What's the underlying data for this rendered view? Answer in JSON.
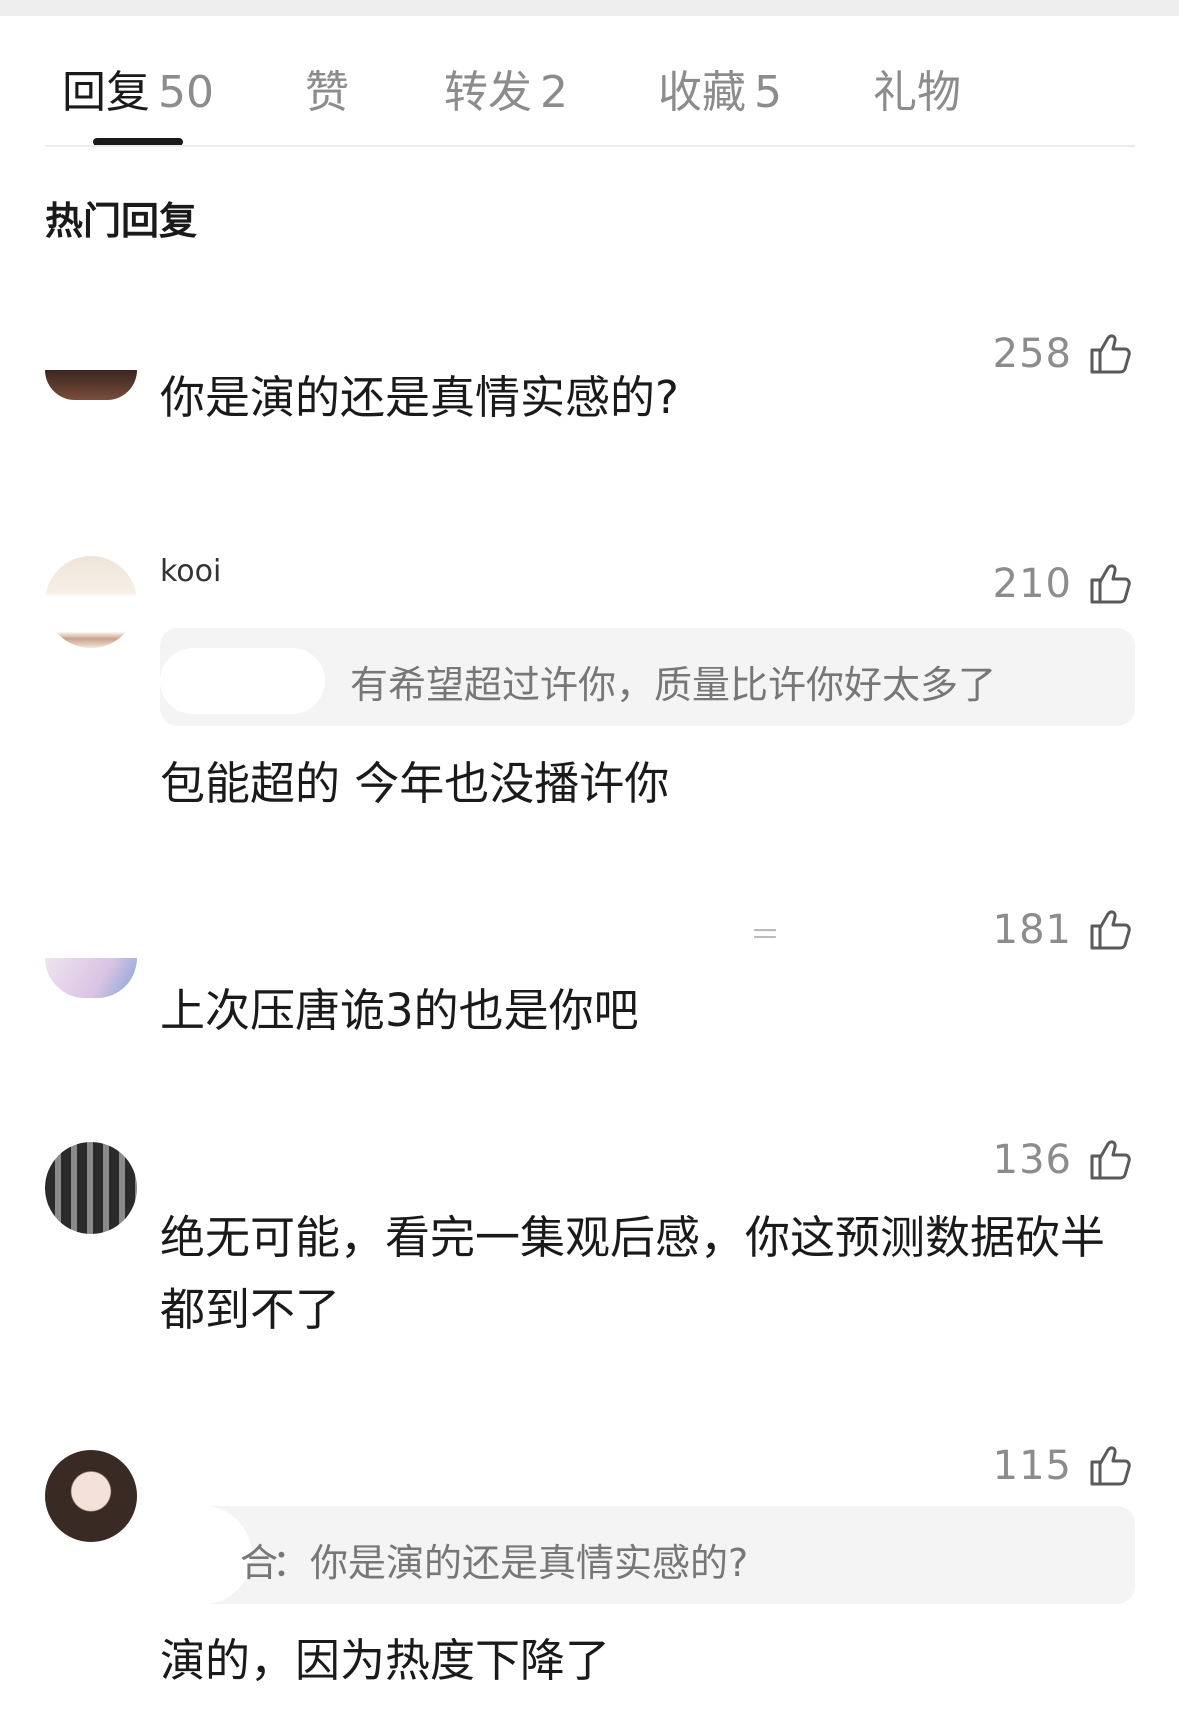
{
  "tabs": [
    {
      "label": "回复",
      "count": "50"
    },
    {
      "label": "赞",
      "count": ""
    },
    {
      "label": "转发",
      "count": "2"
    },
    {
      "label": "收藏",
      "count": "5"
    },
    {
      "label": "礼物",
      "count": ""
    }
  ],
  "section": {
    "title": "热门回复"
  },
  "comments": [
    {
      "likes": "258",
      "text": "你是演的还是真情实感的?",
      "quote": ""
    },
    {
      "likes": "210",
      "text": "包能超的 今年也没播许你",
      "quote": "有希望超过许你，质量比许你好太多了"
    },
    {
      "likes": "181",
      "text": "上次压唐诡3的也是你吧",
      "quote": ""
    },
    {
      "likes": "136",
      "text": "绝无可能，看完一集观后感，你这预测数据砍半都到不了",
      "quote": ""
    },
    {
      "likes": "115",
      "text": "演的，因为热度下降了",
      "quote": "：你是演的还是真情实感的?"
    }
  ],
  "partial_names": {
    "c2": "kooi",
    "c3": "＝",
    "c5_quote_prefix": "合"
  },
  "colors": {
    "text": "#1a1a1a",
    "muted": "#8c8c8c",
    "quote_bg": "#f4f4f5"
  },
  "icons": {
    "like": "thumbs-up-icon"
  }
}
